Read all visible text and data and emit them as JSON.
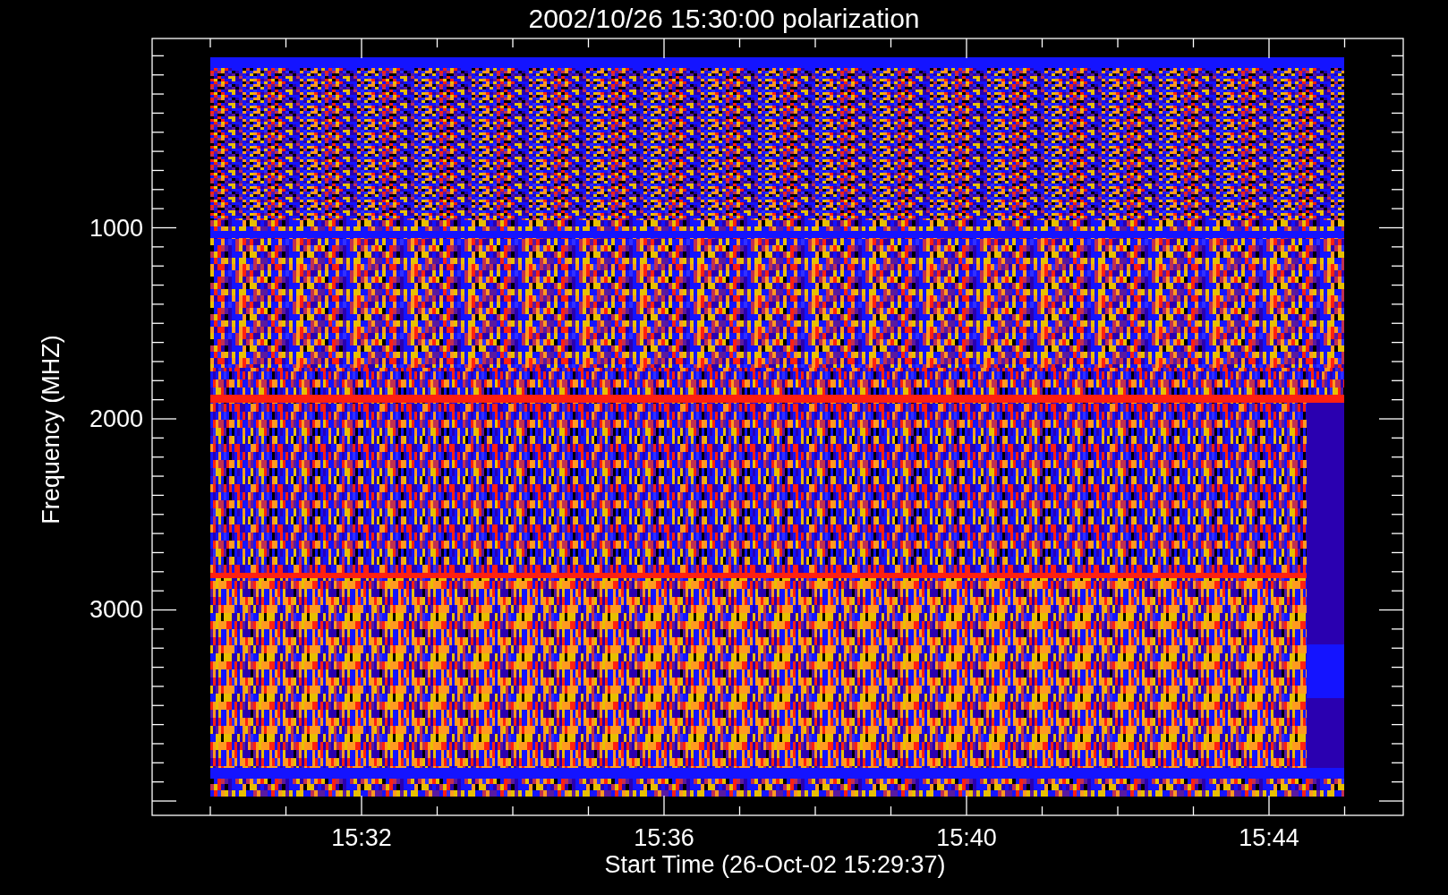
{
  "plot": {
    "title": "2002/10/26 15:30:00 polarization",
    "xlabel": "Start Time (26-Oct-02 15:29:37)",
    "ylabel": "Frequency (MHZ)",
    "xticks": [
      "15:32",
      "15:36",
      "15:40",
      "15:44"
    ],
    "yticks": [
      "1000",
      "2000",
      "3000"
    ]
  }
}
